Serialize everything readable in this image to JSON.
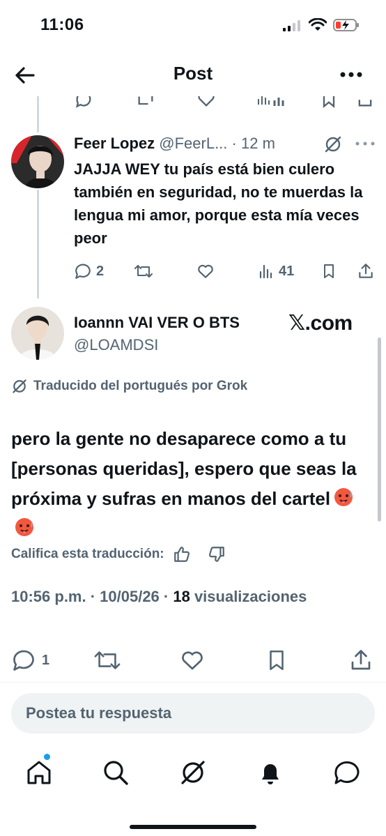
{
  "status_bar": {
    "time": "11:06"
  },
  "nav": {
    "title": "Post"
  },
  "reply": {
    "name": "Feer Lopez",
    "handle": "@FeerL...",
    "separator": "·",
    "time": "12 m",
    "text": "JAJJA WEY tu país está bien culero también en seguridad, no te muerdas la lengua mi amor, porque esta mía veces peor",
    "replies": "2",
    "views": "41"
  },
  "main": {
    "name": "Ioannn VAI VER O BTS",
    "handle": "@LOAMDSI",
    "watermark": ".com",
    "watermark_x": "𝕏",
    "translated_label": "Traducido del portugués por Grok",
    "text": "pero la gente no desaparece como a tu [personas queridas], espero que seas la próxima y sufras en manos del cartel",
    "emoji": "hot-face-emoji",
    "rate_label": "Califica esta traducción:",
    "meta_time": "10:56 p.m. · 10/05/26 · ",
    "views_count": "18",
    "views_label": " visualizaciones",
    "replies": "1"
  },
  "composer": {
    "placeholder": "Postea tu respuesta"
  },
  "tab_bar": {
    "items": [
      "home-icon",
      "search-icon",
      "grok-icon",
      "notifications-icon",
      "messages-icon"
    ]
  },
  "colors": {
    "text": "#0f1419",
    "secondary": "#536471",
    "accent": "#1d9bf0",
    "line": "#cfd9de"
  }
}
